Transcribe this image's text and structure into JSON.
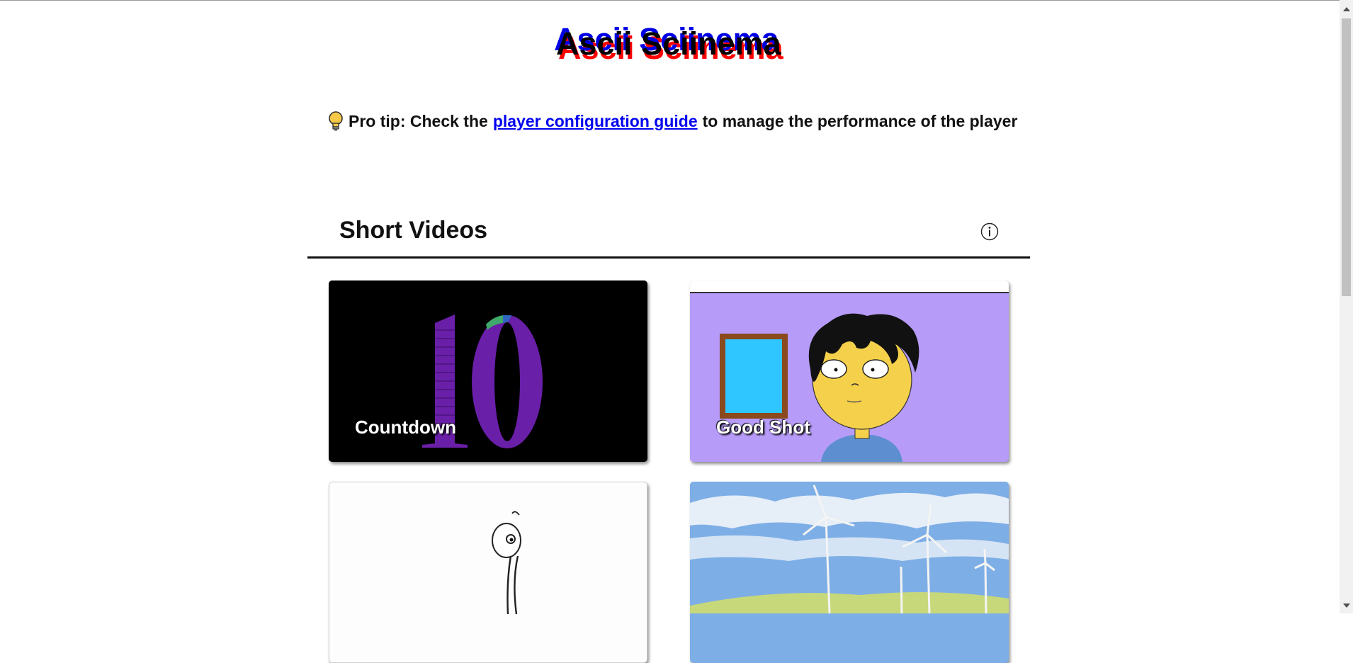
{
  "header": {
    "title": "Ascii Sciinema"
  },
  "protip": {
    "icon": "lightbulb-icon",
    "prefix": "Pro tip: Check the",
    "link_text": "player configuration guide",
    "suffix": "to manage the performance of the player"
  },
  "section": {
    "title": "Short Videos",
    "info_icon": "info-icon"
  },
  "videos": [
    {
      "label": "Countdown",
      "thumbnail": "countdown-number-10"
    },
    {
      "label": "Good Shot",
      "thumbnail": "cartoon-boy-window"
    },
    {
      "label": "",
      "thumbnail": "sketch-stick-figure"
    },
    {
      "label": "",
      "thumbnail": "wind-turbines-landscape"
    }
  ],
  "colors": {
    "title_red": "#ff0000",
    "title_blue": "#0000e6",
    "link": "#0000ee",
    "good_shot_bg": "#b69bf8",
    "countdown_bg": "#000000"
  }
}
